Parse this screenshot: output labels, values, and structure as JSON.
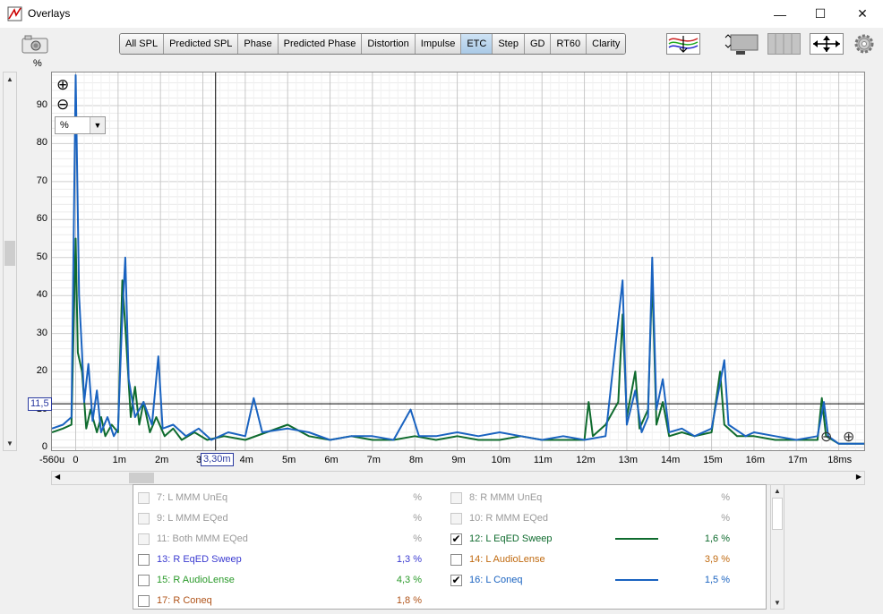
{
  "window": {
    "title": "Overlays",
    "minimize_glyph": "—",
    "maximize_glyph": "☐",
    "close_glyph": "✕"
  },
  "tabs": [
    {
      "label": "All SPL",
      "active": false
    },
    {
      "label": "Predicted SPL",
      "active": false
    },
    {
      "label": "Phase",
      "active": false
    },
    {
      "label": "Predicted Phase",
      "active": false
    },
    {
      "label": "Distortion",
      "active": false
    },
    {
      "label": "Impulse",
      "active": false
    },
    {
      "label": "ETC",
      "active": true
    },
    {
      "label": "Step",
      "active": false
    },
    {
      "label": "GD",
      "active": false
    },
    {
      "label": "RT60",
      "active": false
    },
    {
      "label": "Clarity",
      "active": false
    }
  ],
  "plot": {
    "y_unit": "%",
    "unit_select": "%",
    "cursor_y_label": "11,5",
    "cursor_x_label": "3,30m",
    "cursor_x_prefix": "3",
    "zoom_in_glyph": "⊕",
    "zoom_out_glyph": "⊖"
  },
  "chart_data": {
    "type": "line",
    "ylabel": "%",
    "xlabel": "",
    "ylim": [
      0,
      98
    ],
    "xlim": [
      -0.56,
      18.6
    ],
    "y_ticks": [
      "0",
      "10",
      "20",
      "30",
      "40",
      "50",
      "60",
      "70",
      "80",
      "90"
    ],
    "x_ticks": [
      {
        "v": -0.56,
        "label": "-560u"
      },
      {
        "v": 0,
        "label": "0"
      },
      {
        "v": 1,
        "label": "1m"
      },
      {
        "v": 2,
        "label": "2m"
      },
      {
        "v": 4,
        "label": "4m"
      },
      {
        "v": 5,
        "label": "5m"
      },
      {
        "v": 6,
        "label": "6m"
      },
      {
        "v": 7,
        "label": "7m"
      },
      {
        "v": 8,
        "label": "8m"
      },
      {
        "v": 9,
        "label": "9m"
      },
      {
        "v": 10,
        "label": "10m"
      },
      {
        "v": 11,
        "label": "11m"
      },
      {
        "v": 12,
        "label": "12m"
      },
      {
        "v": 13,
        "label": "13m"
      },
      {
        "v": 14,
        "label": "14m"
      },
      {
        "v": 15,
        "label": "15m"
      },
      {
        "v": 16,
        "label": "16m"
      },
      {
        "v": 17,
        "label": "17m"
      },
      {
        "v": 18,
        "label": "18ms"
      }
    ],
    "cursor": {
      "x": 3.3,
      "y": 11.5
    },
    "series": [
      {
        "name": "12: L EqED Sweep",
        "color": "#0f6b2e",
        "points": [
          [
            -0.56,
            4
          ],
          [
            -0.3,
            5
          ],
          [
            -0.1,
            6
          ],
          [
            0,
            55
          ],
          [
            0.05,
            25
          ],
          [
            0.15,
            20
          ],
          [
            0.25,
            5
          ],
          [
            0.35,
            10
          ],
          [
            0.5,
            4
          ],
          [
            0.6,
            8
          ],
          [
            0.7,
            3
          ],
          [
            0.85,
            6
          ],
          [
            1,
            4
          ],
          [
            1.1,
            44
          ],
          [
            1.18,
            30
          ],
          [
            1.3,
            8
          ],
          [
            1.4,
            16
          ],
          [
            1.5,
            6
          ],
          [
            1.6,
            12
          ],
          [
            1.75,
            4
          ],
          [
            1.9,
            8
          ],
          [
            2.1,
            3
          ],
          [
            2.3,
            5
          ],
          [
            2.5,
            2
          ],
          [
            2.8,
            4
          ],
          [
            3.1,
            2
          ],
          [
            3.5,
            3
          ],
          [
            4,
            2
          ],
          [
            4.5,
            4
          ],
          [
            5,
            6
          ],
          [
            5.5,
            3
          ],
          [
            6,
            2
          ],
          [
            6.5,
            3
          ],
          [
            7,
            2
          ],
          [
            7.5,
            2
          ],
          [
            8,
            3
          ],
          [
            8.5,
            2
          ],
          [
            9,
            3
          ],
          [
            9.5,
            2
          ],
          [
            10,
            2
          ],
          [
            10.5,
            3
          ],
          [
            11,
            2
          ],
          [
            11.5,
            2
          ],
          [
            12,
            2
          ],
          [
            12.1,
            12
          ],
          [
            12.2,
            3
          ],
          [
            12.5,
            6
          ],
          [
            12.8,
            12
          ],
          [
            12.9,
            35
          ],
          [
            13,
            8
          ],
          [
            13.2,
            20
          ],
          [
            13.3,
            5
          ],
          [
            13.5,
            10
          ],
          [
            13.6,
            45
          ],
          [
            13.7,
            6
          ],
          [
            13.85,
            12
          ],
          [
            14,
            3
          ],
          [
            14.3,
            4
          ],
          [
            14.6,
            3
          ],
          [
            15,
            4
          ],
          [
            15.2,
            20
          ],
          [
            15.3,
            6
          ],
          [
            15.6,
            3
          ],
          [
            16,
            3
          ],
          [
            16.5,
            2
          ],
          [
            17,
            2
          ],
          [
            17.5,
            2
          ],
          [
            17.6,
            13
          ],
          [
            17.7,
            3
          ],
          [
            18,
            1
          ],
          [
            18.6,
            1
          ]
        ]
      },
      {
        "name": "16: L Coneq",
        "color": "#1a63c0",
        "points": [
          [
            -0.56,
            5
          ],
          [
            -0.3,
            6
          ],
          [
            -0.1,
            8
          ],
          [
            0,
            98
          ],
          [
            0.08,
            40
          ],
          [
            0.15,
            25
          ],
          [
            0.2,
            12
          ],
          [
            0.3,
            22
          ],
          [
            0.4,
            7
          ],
          [
            0.5,
            15
          ],
          [
            0.6,
            4
          ],
          [
            0.75,
            8
          ],
          [
            0.9,
            3
          ],
          [
            1,
            5
          ],
          [
            1.1,
            35
          ],
          [
            1.17,
            50
          ],
          [
            1.25,
            18
          ],
          [
            1.4,
            8
          ],
          [
            1.6,
            12
          ],
          [
            1.8,
            6
          ],
          [
            1.95,
            24
          ],
          [
            2.05,
            5
          ],
          [
            2.3,
            6
          ],
          [
            2.6,
            3
          ],
          [
            2.9,
            5
          ],
          [
            3.2,
            2
          ],
          [
            3.6,
            4
          ],
          [
            4,
            3
          ],
          [
            4.2,
            13
          ],
          [
            4.4,
            4
          ],
          [
            5,
            5
          ],
          [
            5.5,
            4
          ],
          [
            6,
            2
          ],
          [
            6.5,
            3
          ],
          [
            7,
            3
          ],
          [
            7.5,
            2
          ],
          [
            7.9,
            10
          ],
          [
            8.1,
            3
          ],
          [
            8.5,
            3
          ],
          [
            9,
            4
          ],
          [
            9.5,
            3
          ],
          [
            10,
            4
          ],
          [
            10.5,
            3
          ],
          [
            11,
            2
          ],
          [
            11.5,
            3
          ],
          [
            12,
            2
          ],
          [
            12.5,
            3
          ],
          [
            12.9,
            44
          ],
          [
            13,
            6
          ],
          [
            13.2,
            15
          ],
          [
            13.35,
            4
          ],
          [
            13.5,
            8
          ],
          [
            13.6,
            50
          ],
          [
            13.7,
            10
          ],
          [
            13.85,
            18
          ],
          [
            14,
            4
          ],
          [
            14.3,
            5
          ],
          [
            14.6,
            3
          ],
          [
            15,
            5
          ],
          [
            15.3,
            23
          ],
          [
            15.4,
            6
          ],
          [
            15.8,
            3
          ],
          [
            16,
            4
          ],
          [
            16.5,
            3
          ],
          [
            17,
            2
          ],
          [
            17.5,
            3
          ],
          [
            17.65,
            12
          ],
          [
            17.75,
            3
          ],
          [
            18,
            1
          ],
          [
            18.6,
            1
          ]
        ]
      }
    ]
  },
  "legend": {
    "left": [
      {
        "label": "7: L MMM UnEq",
        "value": "%",
        "color": "#9a9a9a",
        "checked": false,
        "disabled": true
      },
      {
        "label": "9: L MMM EQed",
        "value": "%",
        "color": "#9a9a9a",
        "checked": false,
        "disabled": true
      },
      {
        "label": "11: Both MMM EQed",
        "value": "%",
        "color": "#9a9a9a",
        "checked": false,
        "disabled": true
      },
      {
        "label": "13: R EqED Sweep",
        "value": "1,3 %",
        "color": "#3b3bd1",
        "checked": false,
        "disabled": false
      },
      {
        "label": "15: R AudioLense",
        "value": "4,3 %",
        "color": "#2a9a2a",
        "checked": false,
        "disabled": false
      },
      {
        "label": "17: R Coneq",
        "value": "1,8 %",
        "color": "#b0541a",
        "checked": false,
        "disabled": false
      }
    ],
    "right": [
      {
        "label": "8: R MMM UnEq",
        "value": "%",
        "color": "#9a9a9a",
        "checked": false,
        "disabled": true,
        "line": false
      },
      {
        "label": "10: R MMM EQed",
        "value": "%",
        "color": "#9a9a9a",
        "checked": false,
        "disabled": true,
        "line": false
      },
      {
        "label": "12: L EqED Sweep",
        "value": "1,6 %",
        "color": "#0f6b2e",
        "checked": true,
        "disabled": false,
        "line": true
      },
      {
        "label": "14: L AudioLense",
        "value": "3,9 %",
        "color": "#c06a10",
        "checked": false,
        "disabled": false,
        "line": false
      },
      {
        "label": "16: L Coneq",
        "value": "1,5 %",
        "color": "#1a63c0",
        "checked": true,
        "disabled": false,
        "line": true
      }
    ]
  }
}
